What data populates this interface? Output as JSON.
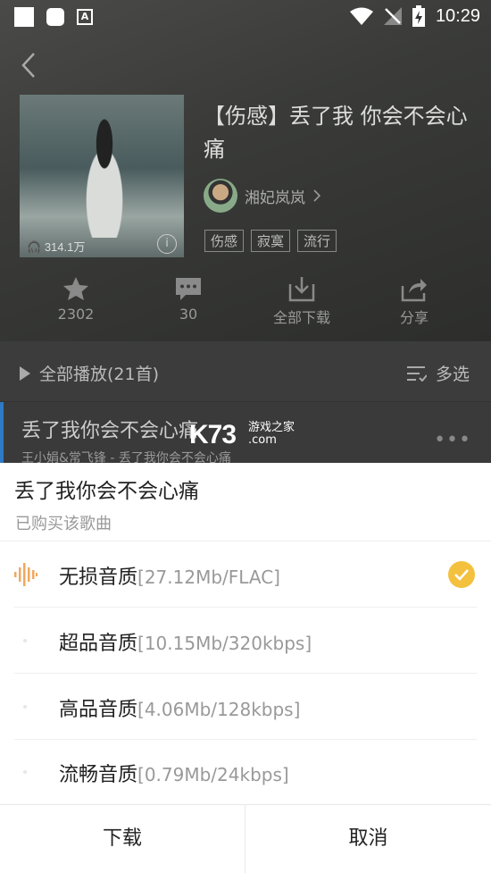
{
  "status_bar": {
    "time": "10:29"
  },
  "playlist": {
    "title": "【伤感】丢了我 你会不会心痛",
    "play_count": "314.1万",
    "author": "湘妃岚岚",
    "tags": [
      "伤感",
      "寂寞",
      "流行"
    ]
  },
  "actions": [
    {
      "icon": "star-icon",
      "label": "2302"
    },
    {
      "icon": "comment-icon",
      "label": "30"
    },
    {
      "icon": "download-icon",
      "label": "全部下载"
    },
    {
      "icon": "share-icon",
      "label": "分享"
    }
  ],
  "list_header": {
    "play_all": "全部播放(21首)",
    "multi_select": "多选"
  },
  "current_song": {
    "title": "丢了我你会不会心痛",
    "subtitle": "王小娟&常飞锋 - 丢了我你会不会心痛"
  },
  "watermark": {
    "brand": "K73",
    "text1": "游戏之家",
    "text2": ".com"
  },
  "sheet": {
    "title": "丢了我你会不会心痛",
    "subtitle": "已购买该歌曲",
    "options": [
      {
        "name": "无损音质",
        "detail": "[27.12Mb/FLAC]",
        "selected": true
      },
      {
        "name": "超品音质",
        "detail": "[10.15Mb/320kbps]",
        "selected": false
      },
      {
        "name": "高品音质",
        "detail": "[4.06Mb/128kbps]",
        "selected": false
      },
      {
        "name": "流畅音质",
        "detail": "[0.79Mb/24kbps]",
        "selected": false
      }
    ],
    "download_label": "下载",
    "cancel_label": "取消"
  },
  "colors": {
    "accent": "#f4c13f",
    "bars_icon": "#f0a860",
    "active_bar": "#2e7ac6"
  }
}
